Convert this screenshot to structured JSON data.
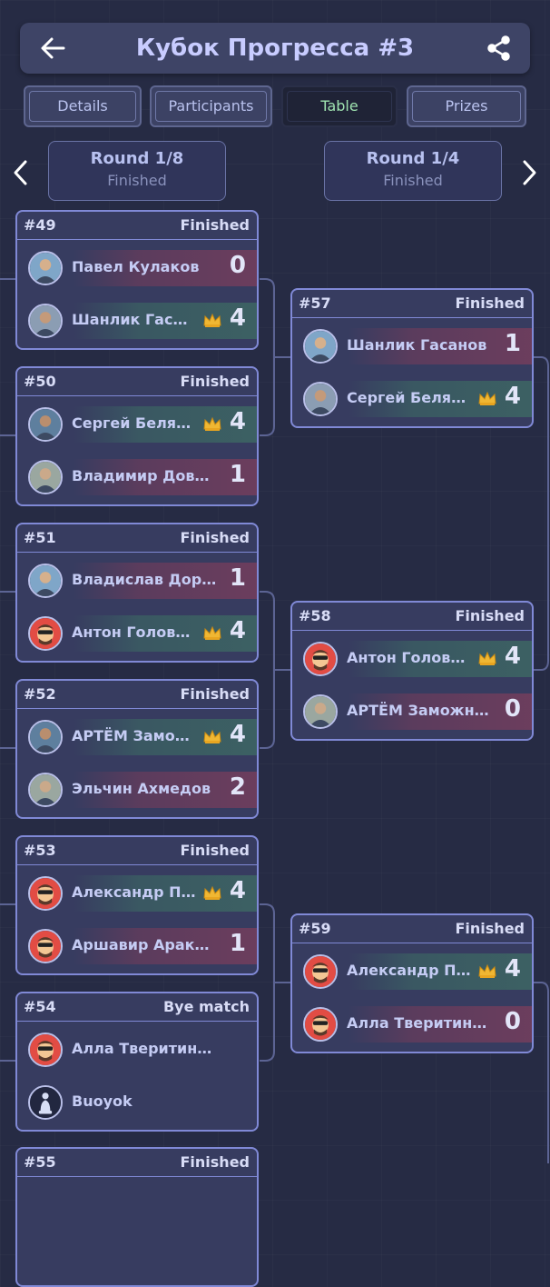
{
  "header": {
    "title": "Кубок Прогресса #3"
  },
  "tabs": [
    {
      "label": "Details"
    },
    {
      "label": "Participants"
    },
    {
      "label": "Table",
      "active": true
    },
    {
      "label": "Prizes"
    }
  ],
  "rounds": [
    {
      "name": "Round 1/8",
      "status": "Finished"
    },
    {
      "name": "Round 1/4",
      "status": "Finished"
    }
  ],
  "colors": {
    "background": "#262b44",
    "card_border": "#8089d6",
    "active_tab_text": "#9fe3b0",
    "winner_band": "#3e7064",
    "loser_band": "#823e5c"
  },
  "matches": [
    {
      "id": "#49",
      "status": "Finished",
      "players": [
        {
          "name": "Павел Кулаков",
          "score": "0",
          "winner": false,
          "avatar": "photo-avatar"
        },
        {
          "name": "Шанлик Гасанов",
          "score": "4",
          "winner": true,
          "avatar": "photo-avatar"
        }
      ]
    },
    {
      "id": "#50",
      "status": "Finished",
      "players": [
        {
          "name": "Сергей Беляков",
          "score": "4",
          "winner": true,
          "avatar": "photo-avatar"
        },
        {
          "name": "Владимир Довыде...",
          "score": "1",
          "winner": false,
          "avatar": "photo-avatar"
        }
      ]
    },
    {
      "id": "#51",
      "status": "Finished",
      "players": [
        {
          "name": "Владислав Дорого...",
          "score": "1",
          "winner": false,
          "avatar": "photo-avatar"
        },
        {
          "name": "Антон Голова...",
          "score": "4",
          "winner": true,
          "avatar": "cartoon-avatar"
        }
      ]
    },
    {
      "id": "#52",
      "status": "Finished",
      "players": [
        {
          "name": "АРТЁМ Замож...",
          "score": "4",
          "winner": true,
          "avatar": "photo-avatar"
        },
        {
          "name": "Эльчин Ахмедов",
          "score": "2",
          "winner": false,
          "avatar": "photo-avatar"
        }
      ]
    },
    {
      "id": "#53",
      "status": "Finished",
      "players": [
        {
          "name": "Александр По...",
          "score": "4",
          "winner": true,
          "avatar": "cartoon-avatar"
        },
        {
          "name": "Аршавир Аракелян",
          "score": "1",
          "winner": false,
          "avatar": "cartoon-avatar"
        }
      ]
    },
    {
      "id": "#54",
      "status": "Bye match",
      "players": [
        {
          "name": "Алла Тверитинова",
          "score": "",
          "winner": false,
          "avatar": "cartoon-avatar"
        },
        {
          "name": "Buoyok",
          "score": "",
          "winner": false,
          "avatar": "bot-avatar"
        }
      ]
    },
    {
      "id": "#55",
      "status": "Finished",
      "players": []
    },
    {
      "id": "#57",
      "status": "Finished",
      "players": [
        {
          "name": "Шанлик Гасанов",
          "score": "1",
          "winner": false,
          "avatar": "photo-avatar"
        },
        {
          "name": "Сергей Беляков",
          "score": "4",
          "winner": true,
          "avatar": "photo-avatar"
        }
      ]
    },
    {
      "id": "#58",
      "status": "Finished",
      "players": [
        {
          "name": "Антон Голова...",
          "score": "4",
          "winner": true,
          "avatar": "cartoon-avatar"
        },
        {
          "name": "АРТЁМ Заможний",
          "score": "0",
          "winner": false,
          "avatar": "photo-avatar"
        }
      ]
    },
    {
      "id": "#59",
      "status": "Finished",
      "players": [
        {
          "name": "Александр По...",
          "score": "4",
          "winner": true,
          "avatar": "cartoon-avatar"
        },
        {
          "name": "Алла Тверитинова",
          "score": "0",
          "winner": false,
          "avatar": "cartoon-avatar"
        }
      ]
    }
  ]
}
